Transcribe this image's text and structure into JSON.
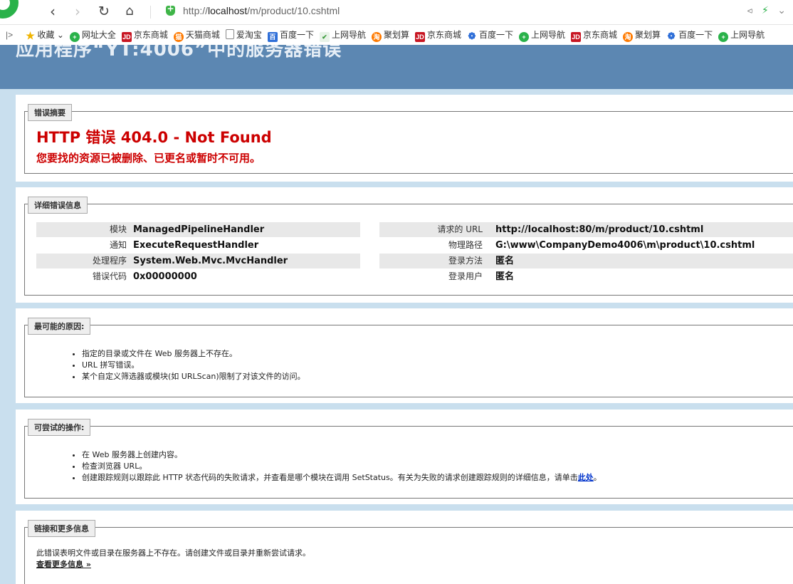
{
  "browser": {
    "url_prefix": "http://",
    "url_host": "localhost",
    "url_path": "/m/product/10.cshtml",
    "bookmarks": [
      {
        "label": "收藏",
        "icon": "star-icon"
      },
      {
        "label": "网址大全",
        "icon": "nav-icon"
      },
      {
        "label": "京东商城",
        "icon": "jd-icon"
      },
      {
        "label": "天猫商城",
        "icon": "tmall-icon"
      },
      {
        "label": "爱淘宝",
        "icon": "doc-icon"
      },
      {
        "label": "百度一下",
        "icon": "baidu-icon"
      },
      {
        "label": "上网导航",
        "icon": "hao-icon"
      },
      {
        "label": "聚划算",
        "icon": "taobao-icon"
      },
      {
        "label": "京东商城",
        "icon": "jd-icon"
      },
      {
        "label": "百度一下",
        "icon": "paw-icon"
      },
      {
        "label": "上网导航",
        "icon": "nav-icon"
      },
      {
        "label": "京东商城",
        "icon": "jd-icon"
      },
      {
        "label": "聚划算",
        "icon": "taobao-icon"
      },
      {
        "label": "百度一下",
        "icon": "paw-icon"
      },
      {
        "label": "上网导航",
        "icon": "nav-icon"
      }
    ]
  },
  "page": {
    "summary": {
      "legend": "错误摘要",
      "title": "HTTP 错误 404.0 - Not Found",
      "message": "您要找的资源已被删除、已更名或暂时不可用。"
    },
    "details": {
      "legend": "详细错误信息",
      "left": [
        {
          "label": "模块",
          "value": "ManagedPipelineHandler"
        },
        {
          "label": "通知",
          "value": "ExecuteRequestHandler"
        },
        {
          "label": "处理程序",
          "value": "System.Web.Mvc.MvcHandler"
        },
        {
          "label": "错误代码",
          "value": "0x00000000"
        }
      ],
      "right": [
        {
          "label": "请求的 URL",
          "value": "http://localhost:80/m/product/10.cshtml"
        },
        {
          "label": "物理路径",
          "value": "G:\\www\\CompanyDemo4006\\m\\product\\10.cshtml"
        },
        {
          "label": "登录方法",
          "value": "匿名"
        },
        {
          "label": "登录用户",
          "value": "匿名"
        }
      ]
    },
    "causes": {
      "legend": "最可能的原因:",
      "items": [
        "指定的目录或文件在 Web 服务器上不存在。",
        "URL 拼写错误。",
        "某个自定义筛选器或模块(如 URLScan)限制了对该文件的访问。"
      ]
    },
    "actions": {
      "legend": "可尝试的操作:",
      "items": [
        "在 Web 服务器上创建内容。",
        "检查浏览器 URL。"
      ],
      "last_item_text": "创建跟踪规则以跟踪此 HTTP 状态代码的失败请求，并查看是哪个模块在调用 SetStatus。有关为失败的请求创建跟踪规则的详细信息，请单击",
      "last_item_link": "此处",
      "last_item_end": "。"
    },
    "links": {
      "legend": "链接和更多信息",
      "text": "此错误表明文件或目录在服务器上不存在。请创建文件或目录并重新尝试请求。",
      "more_link": "查看更多信息 »"
    }
  }
}
